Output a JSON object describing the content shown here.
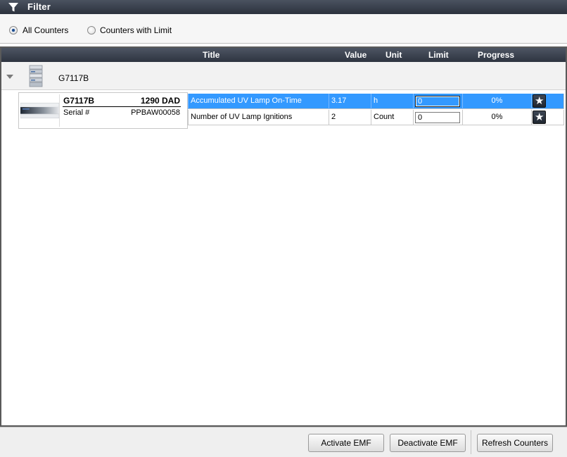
{
  "filter": {
    "title": "Filter",
    "options": [
      {
        "label": "All Counters",
        "checked": true
      },
      {
        "label": "Counters with Limit",
        "checked": false
      }
    ]
  },
  "table": {
    "columns": [
      "Title",
      "Value",
      "Unit",
      "Limit",
      "Progress"
    ]
  },
  "group": {
    "label": "G7117B",
    "expanded": true
  },
  "device": {
    "model": "G7117B",
    "name": "1290 DAD",
    "serial_label": "Serial #",
    "serial_value": "PPBAW00058"
  },
  "counters": [
    {
      "title": "Accumulated UV Lamp On-Time",
      "value": "3.17",
      "unit": "h",
      "limit": "0",
      "progress": "0%",
      "selected": true
    },
    {
      "title": "Number of UV Lamp Ignitions",
      "value": "2",
      "unit": "Count",
      "limit": "0",
      "progress": "0%",
      "selected": false
    }
  ],
  "buttons": {
    "activate": "Activate EMF",
    "deactivate": "Deactivate EMF",
    "refresh": "Refresh Counters"
  },
  "colors": {
    "header_dark": "#2e3440",
    "selection": "#3399ff"
  }
}
